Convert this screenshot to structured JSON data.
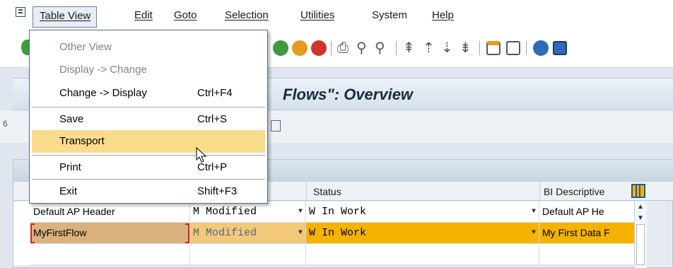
{
  "menubar": {
    "items": [
      {
        "label": "Table View",
        "active": true
      },
      {
        "label": "Edit"
      },
      {
        "label": "Goto"
      },
      {
        "label": "Selection"
      },
      {
        "label": "Utilities"
      },
      {
        "label": "System"
      },
      {
        "label": "Help"
      }
    ]
  },
  "dropdown": {
    "items": [
      {
        "label": "Other View",
        "shortcut": "",
        "disabled": true
      },
      {
        "label": "Display -> Change",
        "shortcut": "",
        "disabled": true
      },
      {
        "label": "Change -> Display",
        "shortcut": "Ctrl+F4",
        "disabled": false
      },
      {
        "label": "Save",
        "shortcut": "Ctrl+S",
        "disabled": false
      },
      {
        "label": "Transport",
        "shortcut": "",
        "disabled": false,
        "highlighted": true
      },
      {
        "label": "Print",
        "shortcut": "Ctrl+P",
        "disabled": false
      },
      {
        "label": "Exit",
        "shortcut": "Shift+F3",
        "disabled": false
      }
    ]
  },
  "title": {
    "text": "Flows\": Overview"
  },
  "subbar": {
    "left_text": "6"
  },
  "table": {
    "columns": [
      "Status",
      "BI Descriptive"
    ],
    "rows": [
      {
        "name": "Default AP Header",
        "modified": "M Modified",
        "status": "W In Work",
        "desc": "Default AP He"
      },
      {
        "name": "MyFirstFlow",
        "modified": "M Modified",
        "status": "W In Work",
        "desc": "My First Data F"
      },
      {
        "name": "",
        "modified": "",
        "status": "",
        "desc": ""
      }
    ]
  },
  "colors": {
    "highlight_row": "#f5b300",
    "menu_highlight": "#f9dc8c",
    "focus_bracket": "#d2231f"
  }
}
